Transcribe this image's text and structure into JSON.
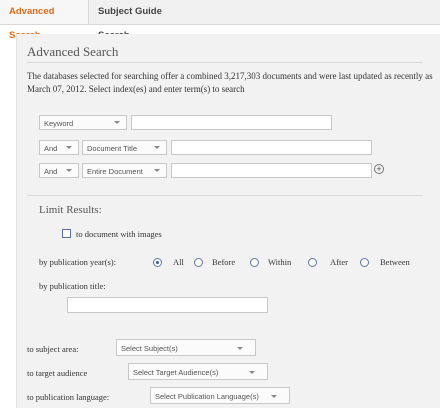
{
  "tabs": [
    {
      "label": "Advanced Search",
      "active": true
    },
    {
      "label": "Subject Guide Search",
      "active": false
    }
  ],
  "colors": {
    "accent": "#e06a17"
  },
  "panel": {
    "title": "Advanced Search",
    "description": "The databases selected for searching offer a combined 3,217,303 documents and were last updated as recently as March 07, 2012. Select index(es) and enter term(s) to search"
  },
  "search_rows": [
    {
      "operator": "",
      "field": "Keyword",
      "value": ""
    },
    {
      "operator": "And",
      "field": "Document Title",
      "value": ""
    },
    {
      "operator": "And",
      "field": "Entire Document",
      "value": ""
    }
  ],
  "add_row_icon": "plus-circle-icon",
  "limits": {
    "heading": "Limit Results:",
    "with_images_label": "to document with images",
    "with_images_checked": false,
    "pub_year_label": "by publication year(s):",
    "pub_year_options": [
      "All",
      "Before",
      "Within",
      "After",
      "Between"
    ],
    "pub_year_selected": "All",
    "pub_title_label": "by publication title:",
    "pub_title_value": "",
    "subject_label": "to subject area:",
    "subject_value": "Select Subject(s)",
    "audience_label": "to target audience",
    "audience_value": "Select Target Audience(s)",
    "language_label": "to publication language:",
    "language_value": "Select Publication Language(s)"
  }
}
